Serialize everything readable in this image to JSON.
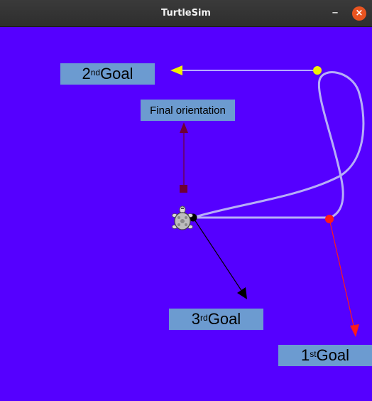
{
  "window": {
    "title": "TurtleSim",
    "minimize_glyph": "–",
    "close_glyph": "×",
    "close_color": "#e95420"
  },
  "canvas": {
    "background": "#5500ff",
    "path_color": "#b7aef7"
  },
  "labels": {
    "goal1": {
      "num": "1",
      "sup": "st",
      "text": " Goal"
    },
    "goal2": {
      "num": "2",
      "sup": "nd",
      "text": " Goal"
    },
    "goal3": {
      "num": "3",
      "sup": "rd",
      "text": " Goal"
    },
    "final": {
      "text": "Final orientation"
    },
    "box_color": "#6c9bd0"
  },
  "markers": {
    "goal1_color": "#ff1a1a",
    "goal2_color": "#f0f000",
    "goal3_color": "#000000",
    "final_color": "#6e0033"
  },
  "icons": [
    "turtle-icon",
    "minimize-icon",
    "close-icon"
  ]
}
